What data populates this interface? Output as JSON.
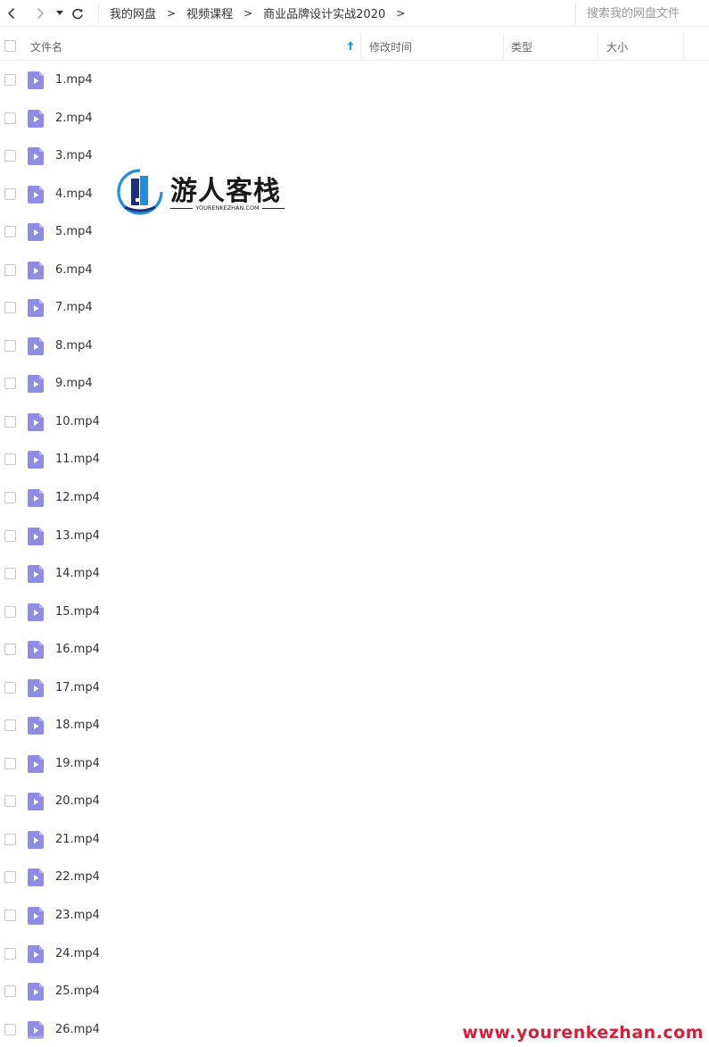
{
  "breadcrumb": [
    "我的网盘",
    "视频课程",
    "商业品牌设计实战2020"
  ],
  "breadcrumb_separator": ">",
  "search": {
    "placeholder": "搜索我的网盘文件"
  },
  "columns": {
    "name": "文件名",
    "mtime": "修改时间",
    "type": "类型",
    "size": "大小"
  },
  "files": [
    "1.mp4",
    "2.mp4",
    "3.mp4",
    "4.mp4",
    "5.mp4",
    "6.mp4",
    "7.mp4",
    "8.mp4",
    "9.mp4",
    "10.mp4",
    "11.mp4",
    "12.mp4",
    "13.mp4",
    "14.mp4",
    "15.mp4",
    "16.mp4",
    "17.mp4",
    "18.mp4",
    "19.mp4",
    "20.mp4",
    "21.mp4",
    "22.mp4",
    "23.mp4",
    "24.mp4",
    "25.mp4",
    "26.mp4"
  ],
  "watermark": {
    "name": "游人客栈",
    "domain": "YOURENKEZHAN.COM",
    "url": "www.yourenkezhan.com"
  },
  "icons": {
    "back": "chevron-left-icon",
    "forward": "chevron-right-icon",
    "dropdown": "caret-down-icon",
    "refresh": "refresh-icon",
    "sort": "sort-ascending-icon",
    "file": "video-file-icon"
  },
  "colors": {
    "file_icon": "#8f8ce6",
    "sort_arrow": "#1aa0e8",
    "watermark_url": "#d81e3a",
    "logo_blue": "#1e8fe0",
    "logo_navy": "#1b2f7a"
  }
}
